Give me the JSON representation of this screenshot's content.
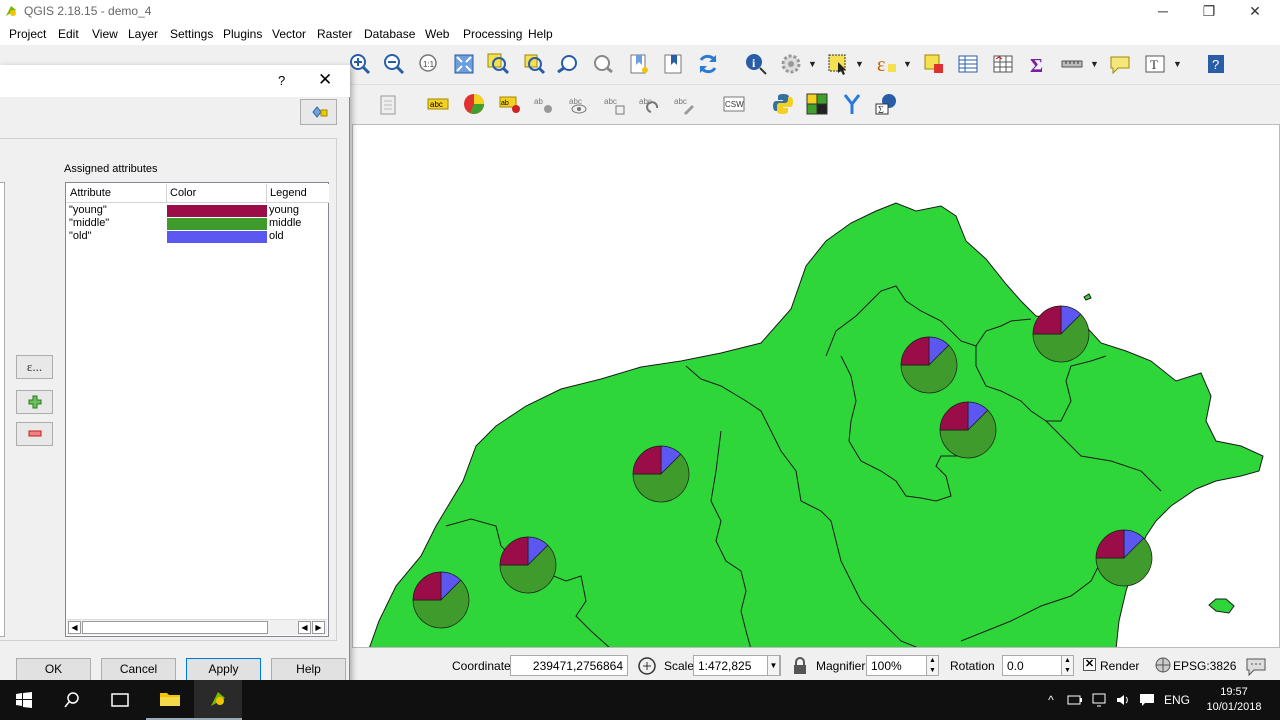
{
  "window": {
    "title": "QGIS 2.18.15 - demo_4"
  },
  "menubar": {
    "items": [
      "Project",
      "Edit",
      "View",
      "Layer",
      "Settings",
      "Plugins",
      "Vector",
      "Raster",
      "Database",
      "Web",
      "Processing",
      "Help"
    ]
  },
  "dialog": {
    "help_glyph": "?",
    "close_glyph": "✕",
    "assigned_label": "Assigned attributes",
    "columns": [
      "Attribute",
      "Color",
      "Legend"
    ],
    "rows": [
      {
        "attribute": "\"young\"",
        "color": "#9b0d49",
        "legend": "young"
      },
      {
        "attribute": "\"middle\"",
        "color": "#3f9b2b",
        "legend": "middle"
      },
      {
        "attribute": "\"old\"",
        "color": "#5b57f0",
        "legend": "old"
      }
    ],
    "expr_button": "ε...",
    "buttons": {
      "ok": "OK",
      "cancel": "Cancel",
      "apply": "Apply",
      "help": "Help"
    }
  },
  "statusbar": {
    "coordinate_label": "Coordinate",
    "coordinate_value": "239471,2756864",
    "scale_label": "Scale",
    "scale_value": "1:472,825",
    "magnifier_label": "Magnifier",
    "magnifier_value": "100%",
    "rotation_label": "Rotation",
    "rotation_value": "0.0",
    "render_label": "Render",
    "epsg": "EPSG:3826"
  },
  "colors": {
    "land": "#2fd63a",
    "young": "#9b0d49",
    "middle": "#3f9b2b",
    "old": "#5b57f0"
  },
  "taskbar": {
    "language": "ENG",
    "time": "19:57",
    "date": "10/01/2018"
  }
}
